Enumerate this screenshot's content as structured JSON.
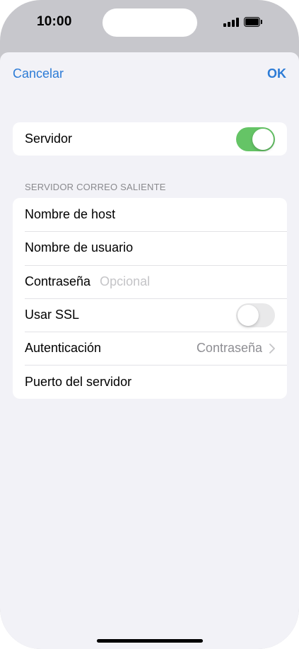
{
  "status_bar": {
    "time": "10:00"
  },
  "nav": {
    "cancel_label": "Cancelar",
    "ok_label": "OK"
  },
  "server_group": {
    "label": "Servidor",
    "enabled": true
  },
  "outgoing_section": {
    "header": "SERVIDOR CORREO SALIENTE",
    "host_label": "Nombre de host",
    "user_label": "Nombre de usuario",
    "password_label": "Contraseña",
    "password_placeholder": "Opcional",
    "ssl_label": "Usar SSL",
    "ssl_enabled": false,
    "auth_label": "Autenticación",
    "auth_value": "Contraseña",
    "port_label": "Puerto del servidor"
  },
  "colors": {
    "accent": "#2c7bd6",
    "toggle_on": "#65c466",
    "background": "#f2f2f7"
  }
}
